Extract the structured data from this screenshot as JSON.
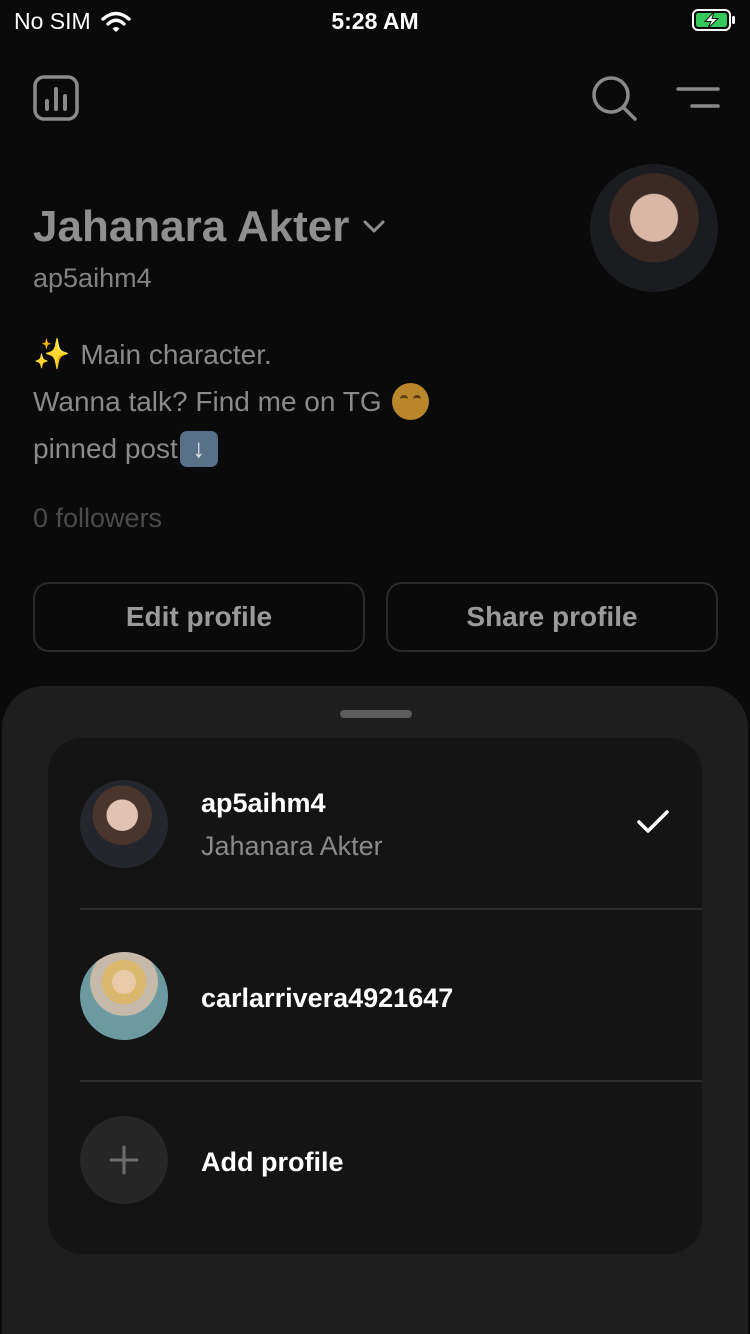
{
  "status_bar": {
    "carrier": "No SIM",
    "time": "5:28 AM"
  },
  "profile": {
    "name": "Jahanara Akter",
    "handle": "ap5aihm4",
    "bio_lines": [
      "Main character.",
      "Wanna talk? Find me on TG",
      "pinned post"
    ],
    "followers": "0 followers",
    "edit_label": "Edit profile",
    "share_label": "Share profile"
  },
  "account_switcher": {
    "accounts": [
      {
        "username": "ap5aihm4",
        "display_name": "Jahanara Akter",
        "selected": true
      },
      {
        "username": "carlarrivera4921647",
        "display_name": "",
        "selected": false
      }
    ],
    "add_label": "Add profile"
  },
  "colors": {
    "background": "#0a0a0a",
    "sheet": "#1e1e1e",
    "card": "#141414",
    "battery_charging": "#34c759"
  },
  "icons": [
    "wifi-icon",
    "battery-icon",
    "insights-icon",
    "search-icon",
    "menu-icon",
    "chevron-down-icon",
    "checkmark-icon",
    "plus-icon"
  ]
}
